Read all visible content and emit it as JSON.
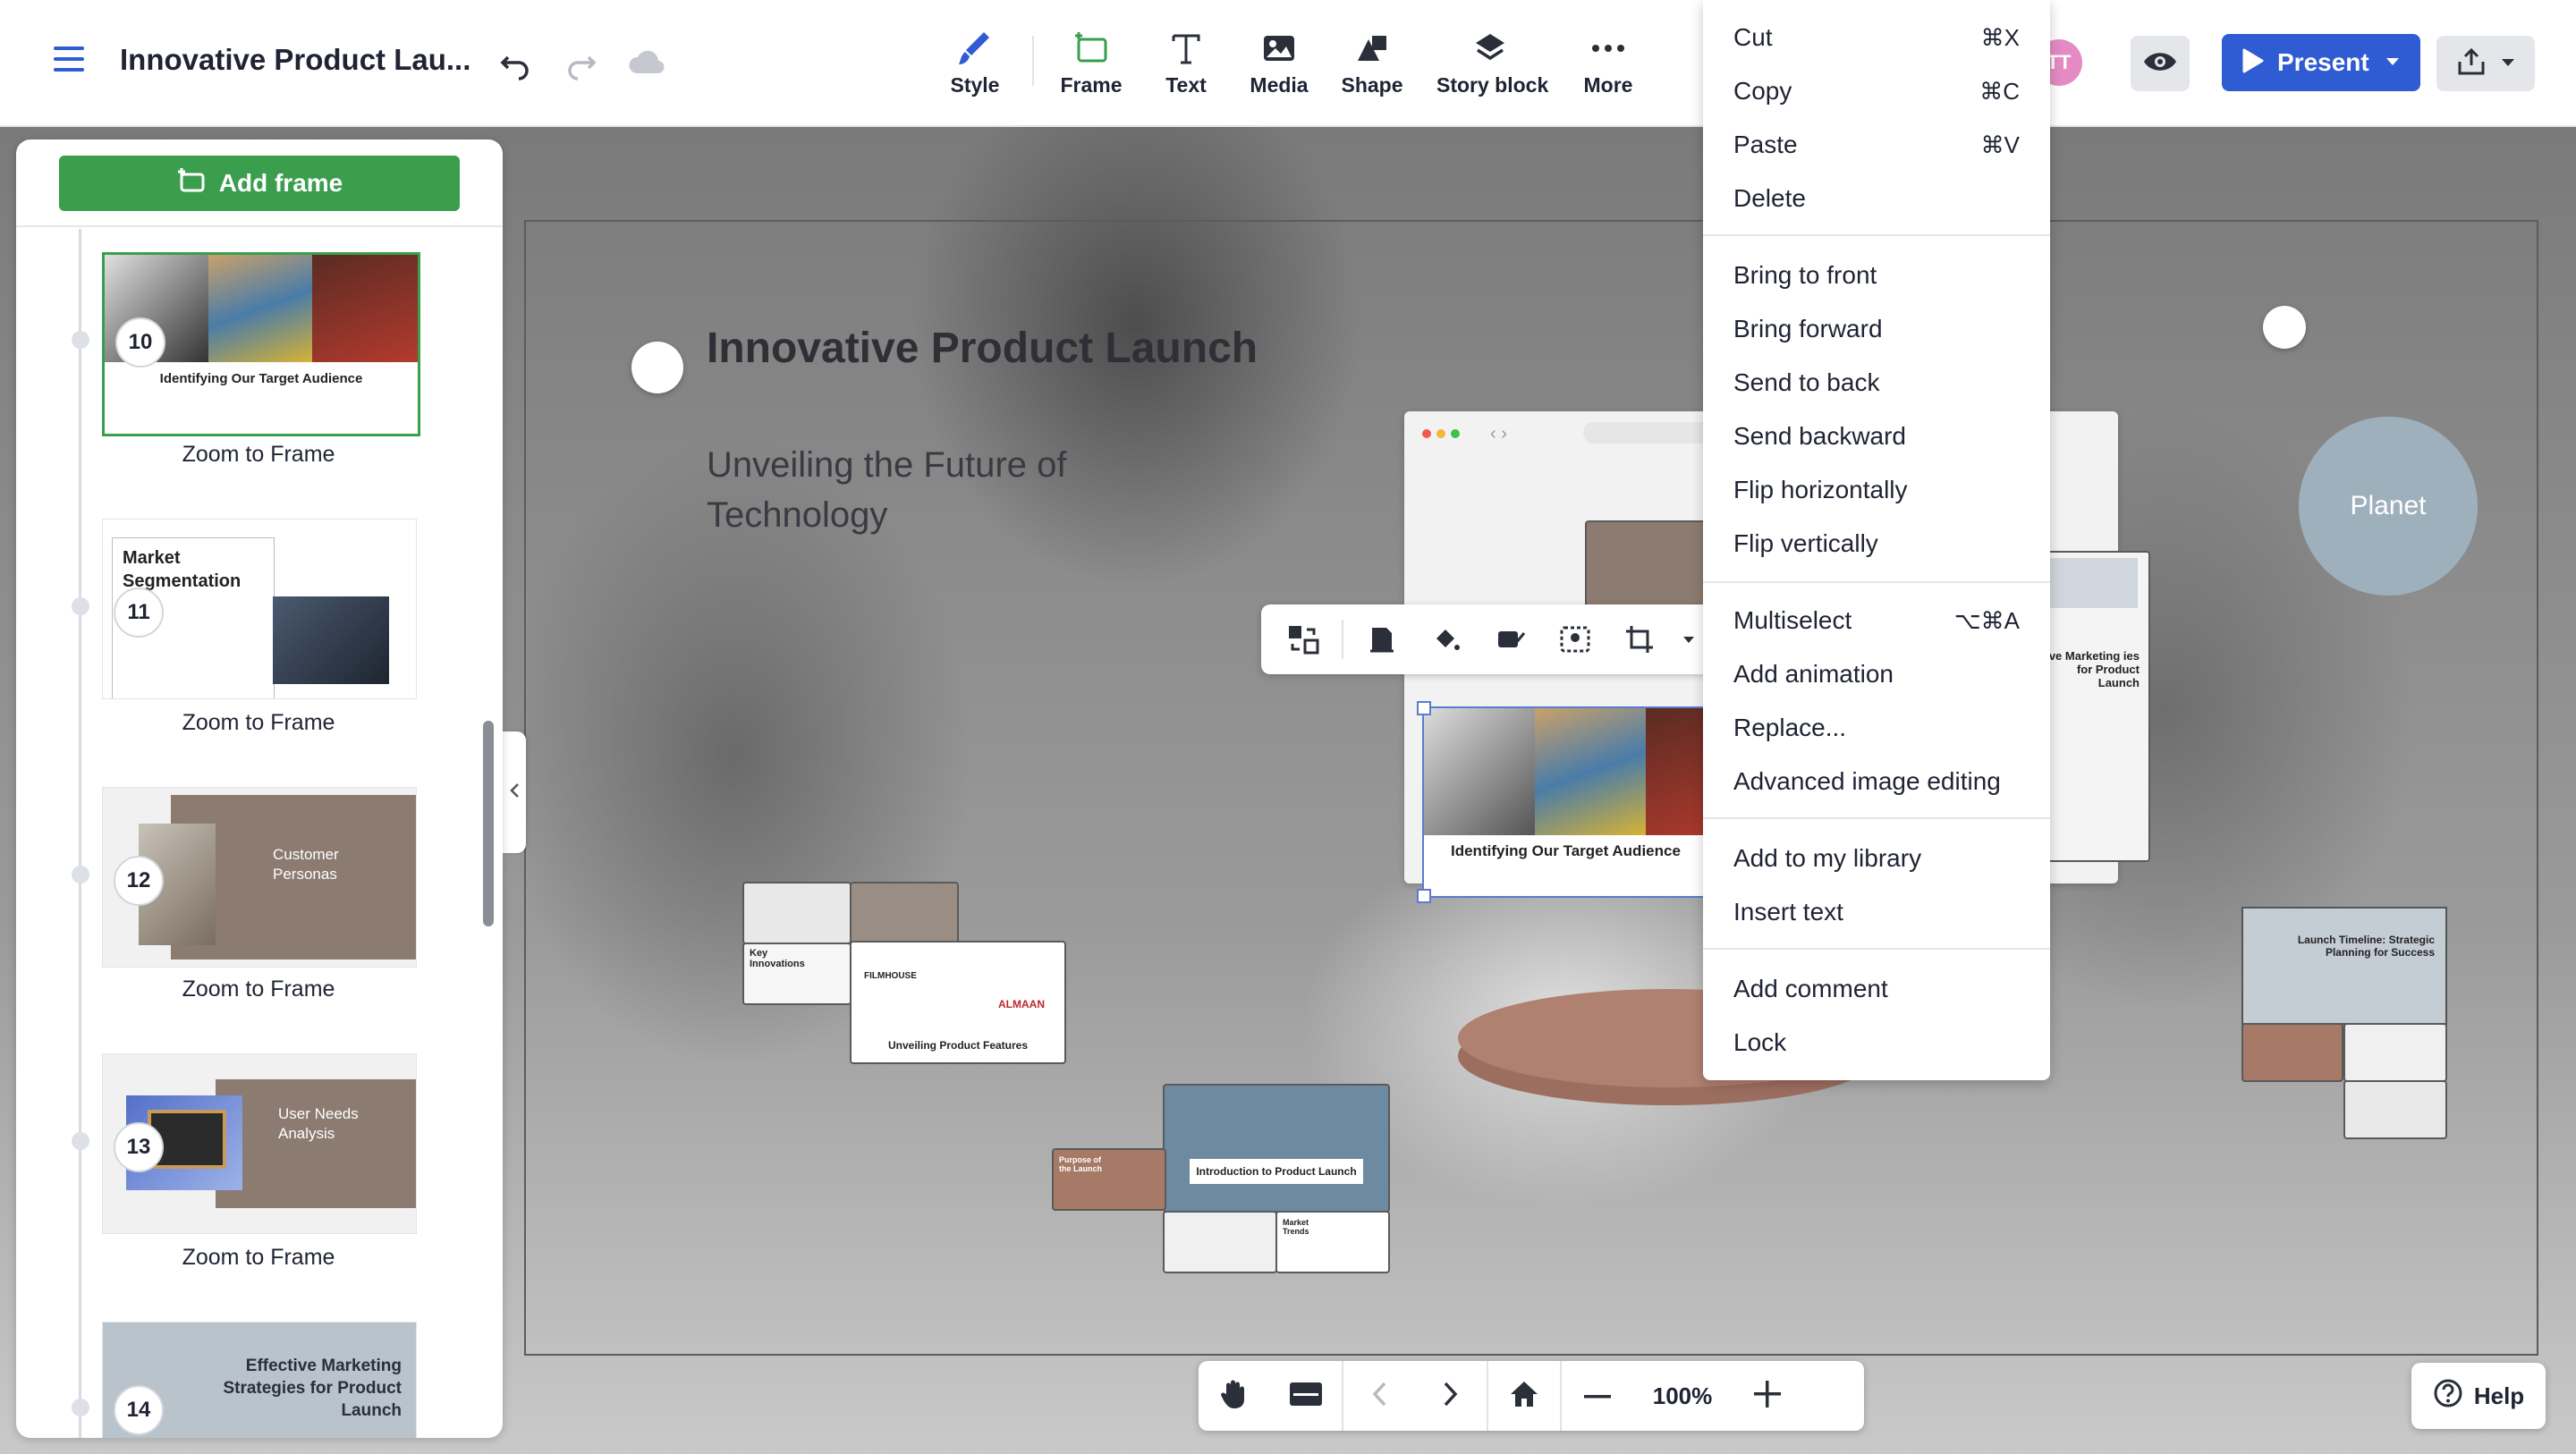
{
  "header": {
    "title": "Innovative Product Lau...",
    "tools": [
      {
        "label": "Style",
        "icon": "brush-icon"
      },
      {
        "label": "Frame",
        "icon": "frame-icon"
      },
      {
        "label": "Text",
        "icon": "text-icon"
      },
      {
        "label": "Media",
        "icon": "image-icon"
      },
      {
        "label": "Shape",
        "icon": "shape-icon"
      },
      {
        "label": "Story block",
        "icon": "layers-icon"
      },
      {
        "label": "More",
        "icon": "more-icon"
      }
    ],
    "avatar_initials": "TT",
    "present_label": "Present"
  },
  "sidebar": {
    "add_frame_label": "Add frame",
    "frames": [
      {
        "number": "10",
        "title": "Identifying Our Target Audience",
        "zoom_label": "Zoom to Frame"
      },
      {
        "number": "11",
        "title": "Market Segmentation",
        "zoom_label": "Zoom to Frame"
      },
      {
        "number": "12",
        "title": "Customer Personas",
        "zoom_label": "Zoom to Frame"
      },
      {
        "number": "13",
        "title": "User Needs Analysis",
        "zoom_label": "Zoom to Frame"
      },
      {
        "number": "14",
        "title": "Effective Marketing Strategies for Product Launch"
      }
    ]
  },
  "canvas": {
    "title": "Innovative Product Launch",
    "subtitle": "Unveiling the Future of Technology",
    "planet_label": "Planet",
    "selected_frame_caption": "Identifying Our Target Audience",
    "cards": {
      "features": "Unveiling Product Features",
      "key_innovations": "Key Innovations",
      "intro": "Introduction to Product Launch",
      "purpose": "Purpose of the Launch",
      "market_trends": "Market Trends",
      "timeline": "Launch Timeline: Strategic Planning for Success",
      "marketing": "tive Marketing ies for Product Launch",
      "logos": [
        "FILMHOUSE",
        "ALMAAN"
      ]
    }
  },
  "context_menu": {
    "groups": [
      [
        {
          "label": "Cut",
          "shortcut": "⌘X"
        },
        {
          "label": "Copy",
          "shortcut": "⌘C"
        },
        {
          "label": "Paste",
          "shortcut": "⌘V"
        },
        {
          "label": "Delete",
          "shortcut": ""
        }
      ],
      [
        {
          "label": "Bring to front",
          "shortcut": ""
        },
        {
          "label": "Bring forward",
          "shortcut": ""
        },
        {
          "label": "Send to back",
          "shortcut": ""
        },
        {
          "label": "Send backward",
          "shortcut": ""
        },
        {
          "label": "Flip horizontally",
          "shortcut": ""
        },
        {
          "label": "Flip vertically",
          "shortcut": ""
        }
      ],
      [
        {
          "label": "Multiselect",
          "shortcut": "⌥⌘A"
        },
        {
          "label": "Add animation",
          "shortcut": ""
        },
        {
          "label": "Replace...",
          "shortcut": ""
        },
        {
          "label": "Advanced image editing",
          "shortcut": ""
        }
      ],
      [
        {
          "label": "Add to my library",
          "shortcut": ""
        },
        {
          "label": "Insert text",
          "shortcut": ""
        }
      ],
      [
        {
          "label": "Add comment",
          "shortcut": ""
        },
        {
          "label": "Lock",
          "shortcut": ""
        }
      ]
    ]
  },
  "bottom_bar": {
    "zoom": "100%",
    "help_label": "Help"
  },
  "colors": {
    "accent": "#2f5bd3",
    "add_frame": "#3a9e4d",
    "avatar": "#e48bc4",
    "stage": "#b08070"
  }
}
